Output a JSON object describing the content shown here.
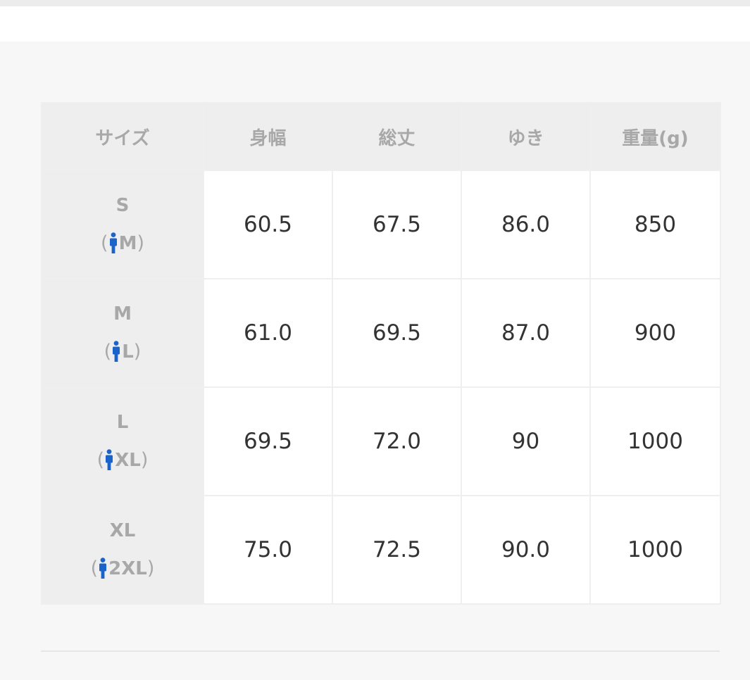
{
  "colors": {
    "page_background": "#f7f7f7",
    "header_background": "#eeeeee",
    "header_text": "#a8a8a8",
    "cell_background": "#ffffff",
    "cell_text": "#333333",
    "person_icon": "#1a63c9"
  },
  "size_table": {
    "headers": [
      "サイズ",
      "身幅",
      "総丈",
      "ゆき",
      "重量(g)"
    ],
    "rows": [
      {
        "size": "S",
        "fit_open": "(",
        "fit_icon": "person-icon",
        "fit_size": "M",
        "fit_close": ")",
        "values": [
          "60.5",
          "67.5",
          "86.0",
          "850"
        ]
      },
      {
        "size": "M",
        "fit_open": "(",
        "fit_icon": "person-icon",
        "fit_size": "L",
        "fit_close": ")",
        "values": [
          "61.0",
          "69.5",
          "87.0",
          "900"
        ]
      },
      {
        "size": "L",
        "fit_open": "(",
        "fit_icon": "person-icon",
        "fit_size": "XL",
        "fit_close": ")",
        "values": [
          "69.5",
          "72.0",
          "90",
          "1000"
        ]
      },
      {
        "size": "XL",
        "fit_open": "(",
        "fit_icon": "person-icon",
        "fit_size": "2XL",
        "fit_close": ")",
        "values": [
          "75.0",
          "72.5",
          "90.0",
          "1000"
        ]
      }
    ]
  }
}
